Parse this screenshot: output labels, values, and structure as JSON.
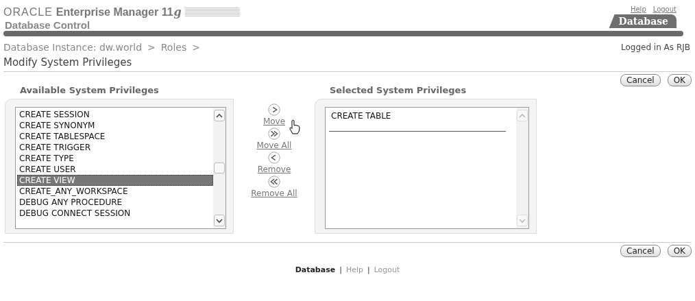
{
  "header": {
    "brand": "ORACLE",
    "product": "Enterprise Manager 11",
    "product_suffix": "g",
    "subtitle": "Database Control",
    "global_links": [
      "Help",
      "Logout"
    ],
    "tabs": [
      {
        "label": "Database",
        "selected": true
      }
    ]
  },
  "breadcrumb": [
    "Database Instance: dw.world",
    "Roles"
  ],
  "breadcrumb_separator": ">",
  "footer_separator": "|",
  "user_info": "Logged in As RJB",
  "page_title": "Modify System Privileges",
  "top_buttons": [
    "Cancel",
    "OK"
  ],
  "available": {
    "title": "Available System Privileges",
    "items": [
      {
        "label": "CREATE SESSION",
        "selected": false
      },
      {
        "label": "CREATE SYNONYM",
        "selected": false
      },
      {
        "label": "CREATE TABLESPACE",
        "selected": false
      },
      {
        "label": "CREATE TRIGGER",
        "selected": false
      },
      {
        "label": "CREATE TYPE",
        "selected": false
      },
      {
        "label": "CREATE USER",
        "selected": false
      },
      {
        "label": "CREATE VIEW",
        "selected": true
      },
      {
        "label": "CREATE_ANY_WORKSPACE",
        "selected": false
      },
      {
        "label": "DEBUG ANY PROCEDURE",
        "selected": false
      },
      {
        "label": "DEBUG CONNECT SESSION",
        "selected": false
      }
    ]
  },
  "shuttle": [
    {
      "kind": "move",
      "label": "Move"
    },
    {
      "kind": "move_all",
      "label": "Move All"
    },
    {
      "kind": "remove",
      "label": "Remove"
    },
    {
      "kind": "remove_all",
      "label": "Remove All"
    }
  ],
  "selected_list": {
    "title": "Selected System Privileges",
    "items": [
      {
        "label": "CREATE TABLE",
        "selected": false
      }
    ]
  },
  "bottom_buttons": [
    "Cancel",
    "OK"
  ],
  "footer_links": [
    {
      "label": "Database",
      "selected": true
    },
    {
      "label": "Help",
      "selected": false
    },
    {
      "label": "Logout",
      "selected": false
    }
  ]
}
